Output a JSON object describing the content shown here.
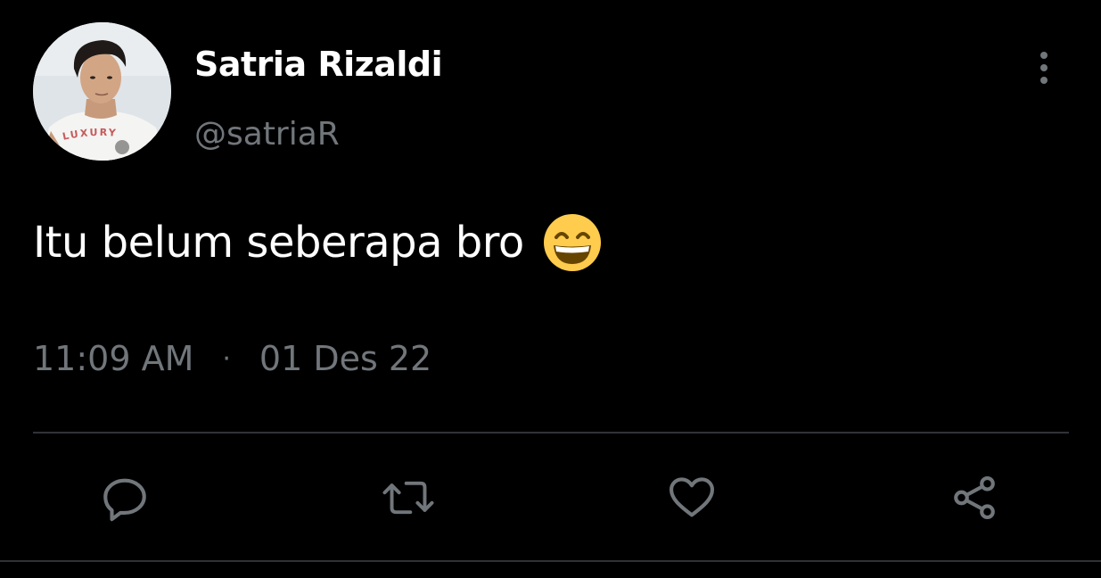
{
  "author": {
    "display_name": "Satria Rizaldi",
    "handle": "@satriaR",
    "avatar_shirt_text": "LUXURY"
  },
  "tweet": {
    "text": "Itu belum seberapa bro",
    "emoji": "grinning-face-with-smiling-eyes"
  },
  "meta": {
    "time": "11:09 AM",
    "separator": "·",
    "date": "01 Des 22"
  },
  "actions": [
    {
      "name": "reply",
      "icon": "speech-bubble-icon"
    },
    {
      "name": "retweet",
      "icon": "retweet-icon"
    },
    {
      "name": "like",
      "icon": "heart-icon"
    },
    {
      "name": "share",
      "icon": "share-icon"
    }
  ],
  "colors": {
    "background": "#000000",
    "text_primary": "#ffffff",
    "text_secondary": "#71767b",
    "divider": "#2f3336",
    "emoji_yellow": "#ffcc4d"
  }
}
